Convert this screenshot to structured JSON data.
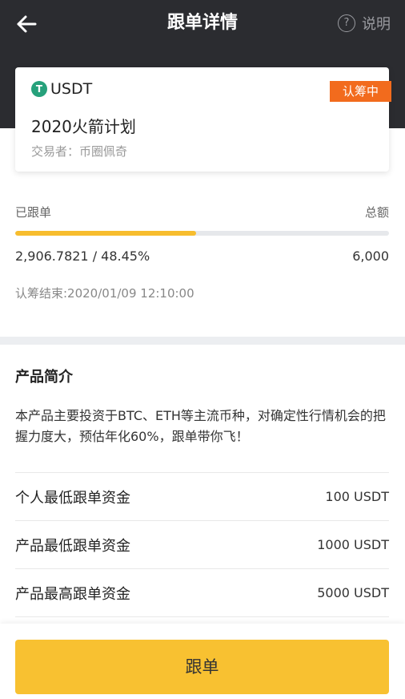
{
  "header": {
    "title": "跟单详情",
    "help_label": "说明",
    "back_icon": "arrow-left-icon",
    "help_icon": "question-circle-icon"
  },
  "card": {
    "coin": "USDT",
    "coin_icon_glyph": "T",
    "coin_color": "#26a17b",
    "status": "认筹中",
    "status_color": "#f26b1d",
    "plan_name": "2020火箭计划",
    "trader": "交易者：币圈佩奇"
  },
  "follow": {
    "followed_label": "已跟单",
    "total_label": "总额",
    "progress_percent": 48.45,
    "followed_value": "2,906.7821 / 48.45%",
    "total_value": "6,000",
    "deadline": "认筹结束:2020/01/09 12:10:00",
    "progress_color": "#f7bd2e"
  },
  "intro": {
    "title": "产品简介",
    "text": "本产品主要投资于BTC、ETH等主流币种，对确定性行情机会的把握力度大，预估年化60%，跟单带你飞！"
  },
  "info": [
    {
      "label": "个人最低跟单资金",
      "value": "100 USDT"
    },
    {
      "label": "产品最低跟单资金",
      "value": "1000 USDT"
    },
    {
      "label": "产品最高跟单资金",
      "value": "5000 USDT"
    }
  ],
  "footer": {
    "button_label": "跟单",
    "button_color": "#f8c131"
  }
}
